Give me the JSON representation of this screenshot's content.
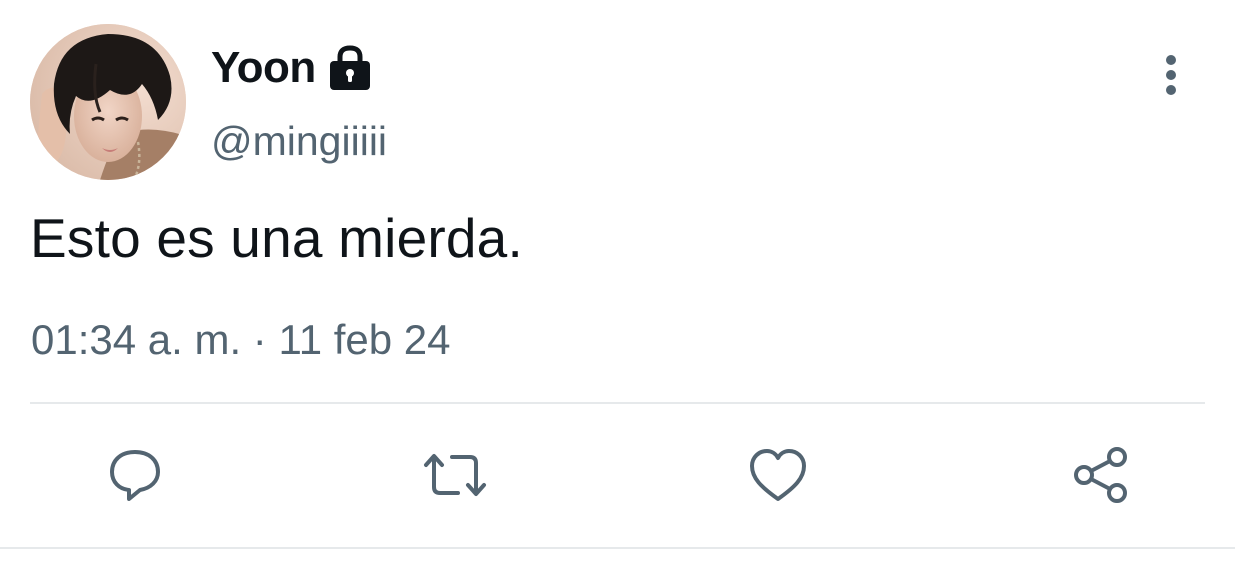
{
  "tweet": {
    "display_name": "Yoon",
    "handle": "@mingiiiii",
    "text": "Esto es una mierda.",
    "timestamp": "01:34 a. m. · 11 feb 24",
    "protected_icon": "lock-icon",
    "avatar_icon": "profile-photo"
  },
  "actions": [
    {
      "icon": "reply-icon"
    },
    {
      "icon": "retweet-icon"
    },
    {
      "icon": "heart-icon"
    },
    {
      "icon": "share-icon"
    }
  ],
  "colors": {
    "text_primary": "#0f1419",
    "text_secondary": "#536471",
    "divider": "#e6e9eb",
    "background": "#ffffff"
  }
}
